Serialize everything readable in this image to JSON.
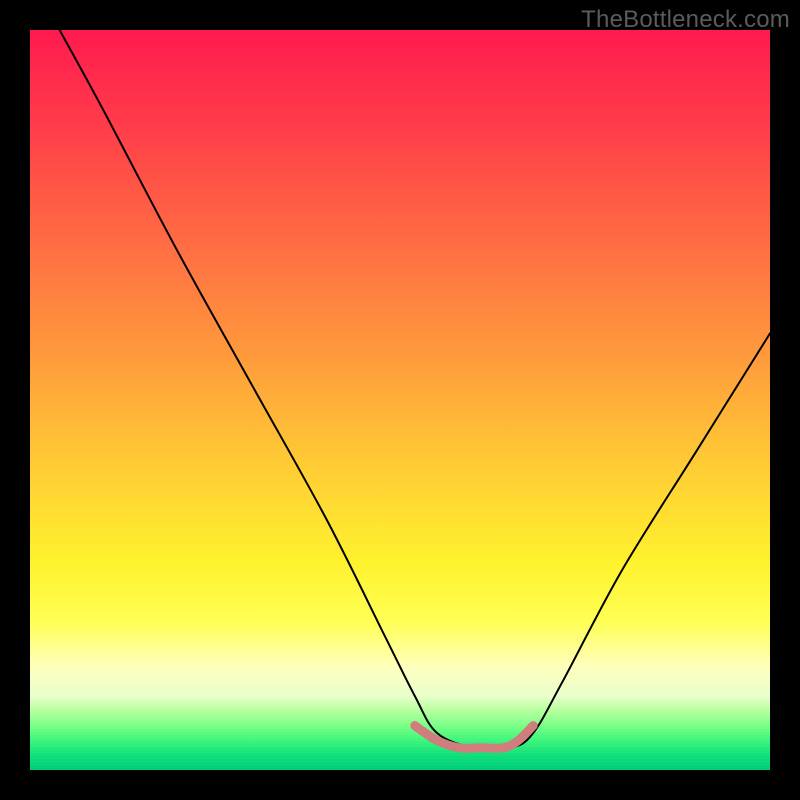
{
  "watermark": {
    "text": "TheBottleneck.com"
  },
  "chart_data": {
    "type": "line",
    "title": "",
    "xlabel": "",
    "ylabel": "",
    "xlim": [
      0,
      100
    ],
    "ylim": [
      0,
      100
    ],
    "grid": false,
    "background": {
      "kind": "vertical-gradient",
      "mapping": "y-value to color (low=green good, high=red bad)",
      "stops": [
        {
          "pct": 0,
          "hex": "#ff1a4f"
        },
        {
          "pct": 12,
          "hex": "#ff3a4a"
        },
        {
          "pct": 28,
          "hex": "#ff6a44"
        },
        {
          "pct": 44,
          "hex": "#ff9a3c"
        },
        {
          "pct": 58,
          "hex": "#ffc935"
        },
        {
          "pct": 72,
          "hex": "#fff22e"
        },
        {
          "pct": 80,
          "hex": "#ffff55"
        },
        {
          "pct": 86,
          "hex": "#ffffbc"
        },
        {
          "pct": 90,
          "hex": "#e9ffcb"
        },
        {
          "pct": 92,
          "hex": "#b5ff9e"
        },
        {
          "pct": 94,
          "hex": "#7aff86"
        },
        {
          "pct": 96,
          "hex": "#3cf57a"
        },
        {
          "pct": 98,
          "hex": "#0ee07a"
        },
        {
          "pct": 100,
          "hex": "#00cc7a"
        }
      ]
    },
    "series": [
      {
        "name": "bottleneck-curve",
        "color": "#000000",
        "stroke_width": 2,
        "x": [
          4,
          10,
          20,
          30,
          40,
          48,
          52,
          55,
          60,
          65,
          68,
          72,
          80,
          90,
          100
        ],
        "values": [
          100,
          89,
          70,
          52,
          34,
          18,
          10,
          5,
          3,
          3,
          5,
          12,
          27,
          43,
          59
        ]
      },
      {
        "name": "optimal-band-highlight",
        "color": "#d47a7a",
        "stroke_width": 7,
        "x": [
          52,
          55,
          58,
          61,
          64,
          66,
          68
        ],
        "values": [
          6,
          4,
          3,
          3,
          3,
          4,
          6
        ]
      }
    ],
    "annotations": []
  }
}
